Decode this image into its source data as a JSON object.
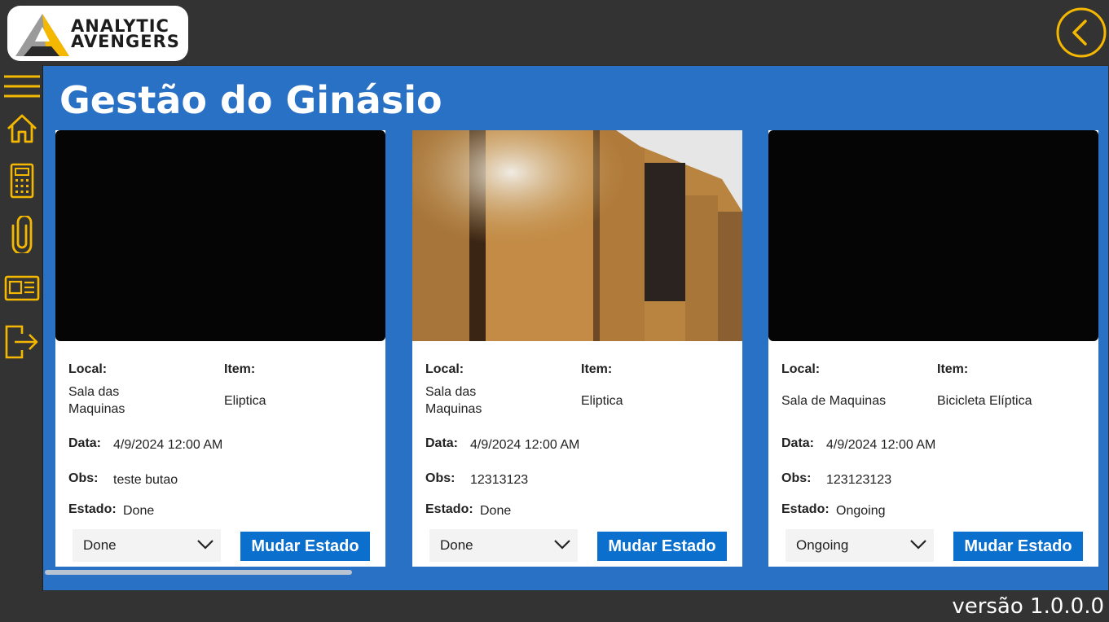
{
  "brand": {
    "line1": "ANALYTIC",
    "line2": "AVENGERS",
    "accent": "#f5b800"
  },
  "nav": {
    "icons": [
      "menu-icon",
      "home-icon",
      "calculator-icon",
      "paperclip-icon",
      "newspaper-icon",
      "logout-icon"
    ],
    "back_icon": "chevron-left-icon"
  },
  "page": {
    "title": "Gestão do Ginásio"
  },
  "labels": {
    "local": "Local:",
    "item": "Item:",
    "data": "Data:",
    "obs": "Obs:",
    "estado": "Estado:",
    "button": "Mudar Estado"
  },
  "cards": [
    {
      "local": "Sala das\nMaquinas",
      "item": "Eliptica",
      "data": "4/9/2024 12:00 AM",
      "obs": "teste butao",
      "estado": "Done",
      "dropdown_value": "Done",
      "image": "black"
    },
    {
      "local": "Sala das\nMaquinas",
      "item": "Eliptica",
      "data": "4/9/2024 12:00 AM",
      "obs": "12313123",
      "estado": "Done",
      "dropdown_value": "Done",
      "image": "photo-wardrobe"
    },
    {
      "local": "Sala de Maquinas",
      "item": "Bicicleta Elíptica",
      "data": "4/9/2024 12:00 AM",
      "obs": "123123123",
      "estado": "Ongoing",
      "dropdown_value": "Ongoing",
      "image": "black"
    }
  ],
  "footer": {
    "version": "versão 1.0.0.0"
  },
  "colors": {
    "main_bg": "#2971c5",
    "button": "#0b6fce",
    "bar": "#333333",
    "icon": "#f5b800"
  }
}
